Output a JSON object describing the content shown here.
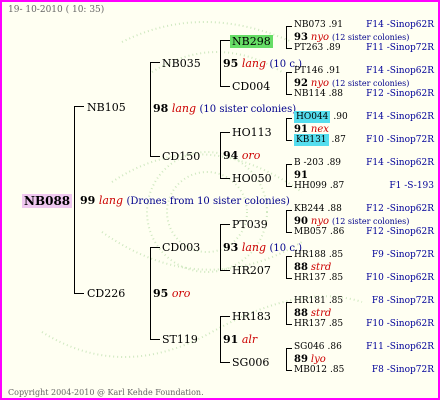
{
  "header": {
    "date": "19- 10-2010 ( 10: 35)"
  },
  "footer": {
    "copyright": "Copyright 2004-2010 @ Karl Kehde Foundation."
  },
  "root": {
    "id": "NB088",
    "number": "99",
    "race": "lang",
    "note": "(Drones from 10 sister colonies)"
  },
  "gen1": [
    {
      "id": "NB105"
    },
    {
      "id": "CD226"
    }
  ],
  "gen1_queens": [
    {
      "number": "98",
      "race": "lang",
      "note": "(10 sister colonies)"
    },
    {
      "number": "95",
      "race": "oro",
      "note": ""
    }
  ],
  "gen2": [
    {
      "id": "NB035"
    },
    {
      "id": "CD150"
    },
    {
      "id": "CD003"
    },
    {
      "id": "ST119"
    }
  ],
  "gen2_queens": [
    {
      "number": "95",
      "race": "lang",
      "note": "(10 c.)"
    },
    {
      "number": "94",
      "race": "oro",
      "note": ""
    },
    {
      "number": "93",
      "race": "lang",
      "note": "(10 c.)"
    },
    {
      "number": "91",
      "race": "alr",
      "note": ""
    }
  ],
  "gen3": [
    {
      "id": "NB298"
    },
    {
      "id": "CD004"
    },
    {
      "id": "HO113"
    },
    {
      "id": "HO050"
    },
    {
      "id": "PT039"
    },
    {
      "id": "HR207"
    },
    {
      "id": "HR183"
    },
    {
      "id": "SG006"
    }
  ],
  "gen3_queens": [
    {
      "number": "93",
      "race": "nyo",
      "note": "(12 sister colonies)"
    },
    {
      "number": "92",
      "race": "nyo",
      "note": "(12 sister colonies)"
    },
    {
      "number": "91",
      "race": "nex",
      "note": ""
    },
    {
      "number": "91",
      "race": "",
      "note": ""
    },
    {
      "number": "90",
      "race": "nyo",
      "note": "(12 sister colonies)"
    },
    {
      "number": "88",
      "race": "strd",
      "note": ""
    },
    {
      "number": "88",
      "race": "strd",
      "note": ""
    },
    {
      "number": "89",
      "race": "lyo",
      "note": ""
    }
  ],
  "gen4": [
    {
      "id": "NB073",
      "score": ".91",
      "line": "F14 -Sinop62R"
    },
    {
      "id": "PT263",
      "score": ".89",
      "line": "F11 -Sinop72R"
    },
    {
      "id": "PT146",
      "score": ".91",
      "line": "F14 -Sinop62R"
    },
    {
      "id": "NB114",
      "score": ".88",
      "line": "F12 -Sinop62R"
    },
    {
      "id": "HO044",
      "score": ".90",
      "line": "F14 -Sinop62R"
    },
    {
      "id": "KB131",
      "score": ".87",
      "line": "F10 -Sinop72R"
    },
    {
      "id": "B -203",
      "score": ".89",
      "line": "F14 -Sinop62R"
    },
    {
      "id": "HH099",
      "score": ".87",
      "line": "F1 -S-193"
    },
    {
      "id": "KB244",
      "score": ".88",
      "line": "F12 -Sinop62R"
    },
    {
      "id": "MB057",
      "score": ".86",
      "line": "F12 -Sinop62R"
    },
    {
      "id": "HR188",
      "score": ".85",
      "line": "F9 -Sinop72R"
    },
    {
      "id": "HR137",
      "score": ".85",
      "line": "F10 -Sinop62R"
    },
    {
      "id": "HR181",
      "score": ".85",
      "line": "F8 -Sinop72R"
    },
    {
      "id": "HR137",
      "score": ".85",
      "line": "F10 -Sinop62R"
    },
    {
      "id": "SG046",
      "score": ".86",
      "line": "F11 -Sinop62R"
    },
    {
      "id": "MB012",
      "score": ".85",
      "line": "F8 -Sinop72R"
    }
  ]
}
